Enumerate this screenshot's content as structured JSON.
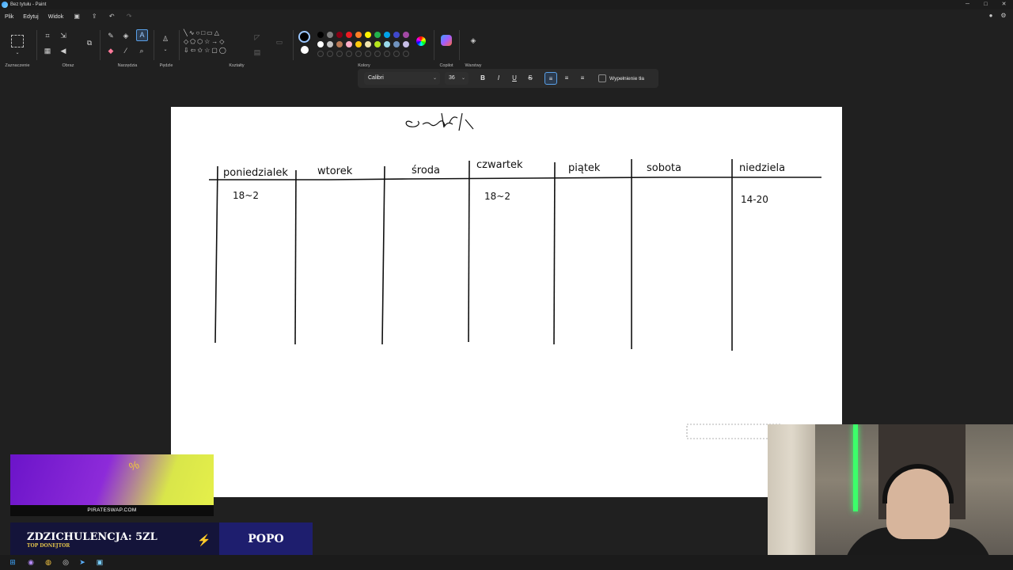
{
  "window": {
    "title": "Bez tytułu - Paint",
    "controls": {
      "minimize": "─",
      "maximize": "□",
      "close": "✕"
    }
  },
  "menu": {
    "items": [
      "Plik",
      "Edytuj",
      "Widok"
    ],
    "icons": [
      "save-icon",
      "share-icon",
      "undo-icon",
      "redo-icon"
    ],
    "right_icons": [
      "account-icon",
      "settings-icon"
    ]
  },
  "ribbon": {
    "groups": {
      "selection": "Zaznaczenie",
      "image": "Obraz",
      "tools": "Narzędzia",
      "brushes": "Pędzle",
      "shapes": "Kształty",
      "colors": "Kolory",
      "copilot": "Copilot",
      "layers": "Warstwy"
    },
    "palette_row1": [
      "#000000",
      "#7f7f7f",
      "#880015",
      "#ed1c24",
      "#ff7f27",
      "#fff200",
      "#22b14c",
      "#00a2e8",
      "#3f48cc",
      "#a349a4"
    ],
    "palette_row2": [
      "#ffffff",
      "#c3c3c3",
      "#b97a57",
      "#ffaec9",
      "#ffc90e",
      "#efe4b0",
      "#b5e61d",
      "#99d9ea",
      "#7092be",
      "#c8bfe7"
    ],
    "accent": "#5aa0e8"
  },
  "text_toolbar": {
    "font": "Calibri",
    "size": "36",
    "bold": "B",
    "italic": "I",
    "underline": "U",
    "strike": "S",
    "fill_background_label": "Wypełnienie tła",
    "fill_background_checked": false
  },
  "canvas": {
    "title_scribble": "Grafik",
    "days": [
      "poniedzialek",
      "wtorek",
      "środa",
      "czwartek",
      "piątek",
      "sobota",
      "niedziela"
    ],
    "cells": {
      "poniedzialek": "18~2",
      "czwartek": "18~2",
      "niedziela": "14-20"
    }
  },
  "overlay": {
    "ad_site": "PIRATESWAP.COM",
    "donor_name": "ZDZICHULENCJA: 5ZL",
    "donor_caption": "TOP DONEJTOR",
    "popo": "POPO"
  }
}
